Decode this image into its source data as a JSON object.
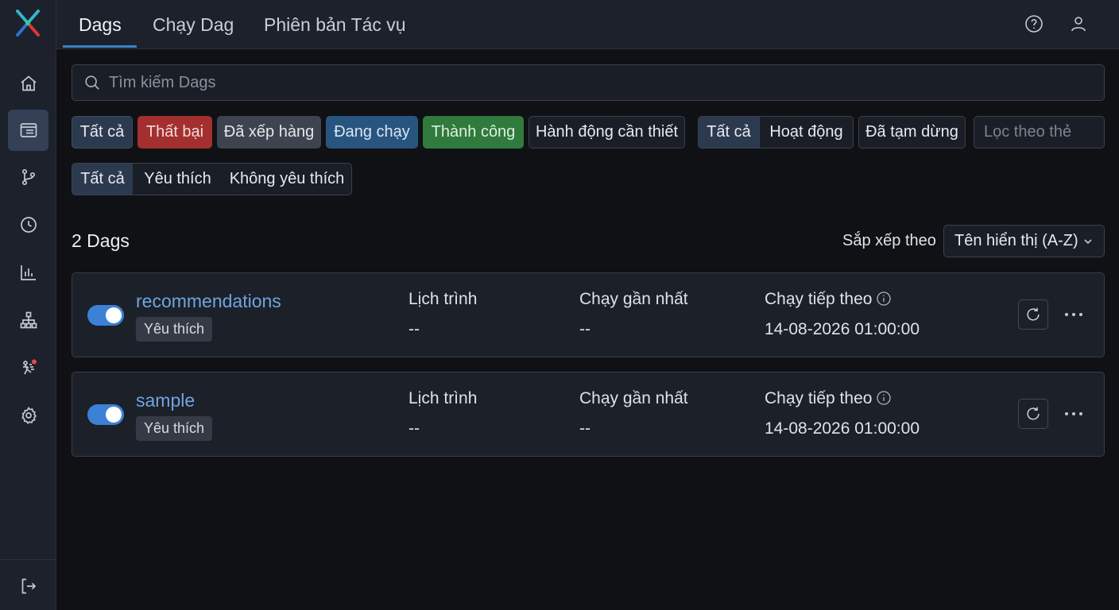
{
  "top_nav": {
    "tabs": [
      {
        "label": "Dags",
        "active": true
      },
      {
        "label": "Chạy Dag",
        "active": false
      },
      {
        "label": "Phiên bản Tác vụ",
        "active": false
      }
    ],
    "right_icons": [
      "help-icon",
      "user-icon"
    ]
  },
  "sidebar": {
    "items": [
      {
        "icon": "home-icon",
        "active": false
      },
      {
        "icon": "dags-icon",
        "active": true
      },
      {
        "icon": "branch-icon",
        "active": false
      },
      {
        "icon": "clock-icon",
        "active": false
      },
      {
        "icon": "bar-chart-icon",
        "active": false
      },
      {
        "icon": "hierarchy-icon",
        "active": false
      },
      {
        "icon": "admin-alert-icon",
        "active": false,
        "badge_color": "#e5484d"
      },
      {
        "icon": "gear-icon",
        "active": false
      }
    ],
    "bottom_icon": "logout-icon"
  },
  "search": {
    "placeholder": "Tìm kiếm Dags"
  },
  "state_filters": [
    {
      "label": "Tất cả",
      "selected": true
    },
    {
      "label": "Thất bại",
      "color": "#a3302e"
    },
    {
      "label": "Đã xếp hàng",
      "color": "#3d444f"
    },
    {
      "label": "Đang chạy",
      "color": "#28557f"
    },
    {
      "label": "Thành công",
      "color": "#2f7a3c"
    },
    {
      "label": "Hành động cần thiết"
    }
  ],
  "active_filters": [
    {
      "label": "Tất cả",
      "selected": true
    },
    {
      "label": "Hoạt động",
      "selected": false
    }
  ],
  "paused_filter": {
    "label": "Đã tạm dừng"
  },
  "tag_filter": {
    "placeholder": "Lọc theo thẻ"
  },
  "favorite_filters": [
    {
      "label": "Tất cả",
      "selected": true
    },
    {
      "label": "Yêu thích",
      "selected": false
    },
    {
      "label": "Không yêu thích",
      "selected": false
    }
  ],
  "results": {
    "count_text": "2 Dags",
    "sort_label": "Sắp xếp theo",
    "sort_value": "Tên hiển thị (A-Z)"
  },
  "dags": [
    {
      "name": "recommendations",
      "enabled": true,
      "badge": "Yêu thích",
      "schedule_label": "Lịch trình",
      "schedule_value": "--",
      "last_run_label": "Chạy gần nhất",
      "last_run_value": "--",
      "next_run_label": "Chạy tiếp theo",
      "next_run_value": "14-08-2026 01:00:00"
    },
    {
      "name": "sample",
      "enabled": true,
      "badge": "Yêu thích",
      "schedule_label": "Lịch trình",
      "schedule_value": "--",
      "last_run_label": "Chạy gần nhất",
      "last_run_value": "--",
      "next_run_label": "Chạy tiếp theo",
      "next_run_value": "14-08-2026 01:00:00"
    }
  ],
  "colors": {
    "accent": "#3b82d6",
    "link": "#6ea5e0",
    "background": "#0f1115",
    "panel": "#1c212b"
  }
}
